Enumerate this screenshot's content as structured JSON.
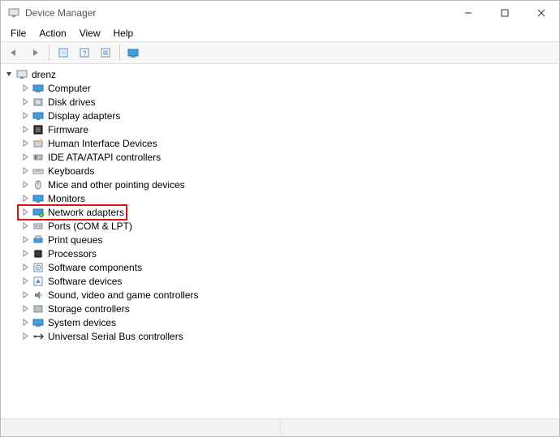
{
  "window": {
    "title": "Device Manager"
  },
  "menu": {
    "file": "File",
    "action": "Action",
    "view": "View",
    "help": "Help"
  },
  "toolbar_icons": {
    "back": "back-icon",
    "forward": "forward-icon",
    "show_hidden": "show-hidden-icon",
    "help": "help-icon",
    "properties": "properties-icon",
    "scan": "scan-icon"
  },
  "tree": {
    "root": "drenz",
    "items": [
      {
        "label": "Computer",
        "icon": "computer-icon"
      },
      {
        "label": "Disk drives",
        "icon": "disk-icon"
      },
      {
        "label": "Display adapters",
        "icon": "display-icon"
      },
      {
        "label": "Firmware",
        "icon": "firmware-icon"
      },
      {
        "label": "Human Interface Devices",
        "icon": "hid-icon"
      },
      {
        "label": "IDE ATA/ATAPI controllers",
        "icon": "ide-icon"
      },
      {
        "label": "Keyboards",
        "icon": "keyboard-icon"
      },
      {
        "label": "Mice and other pointing devices",
        "icon": "mouse-icon"
      },
      {
        "label": "Monitors",
        "icon": "monitor-icon"
      },
      {
        "label": "Network adapters",
        "icon": "network-icon",
        "highlighted": true
      },
      {
        "label": "Ports (COM & LPT)",
        "icon": "ports-icon"
      },
      {
        "label": "Print queues",
        "icon": "printer-icon"
      },
      {
        "label": "Processors",
        "icon": "cpu-icon"
      },
      {
        "label": "Software components",
        "icon": "software-comp-icon"
      },
      {
        "label": "Software devices",
        "icon": "software-dev-icon"
      },
      {
        "label": "Sound, video and game controllers",
        "icon": "sound-icon"
      },
      {
        "label": "Storage controllers",
        "icon": "storage-icon"
      },
      {
        "label": "System devices",
        "icon": "system-icon"
      },
      {
        "label": "Universal Serial Bus controllers",
        "icon": "usb-icon"
      }
    ]
  }
}
